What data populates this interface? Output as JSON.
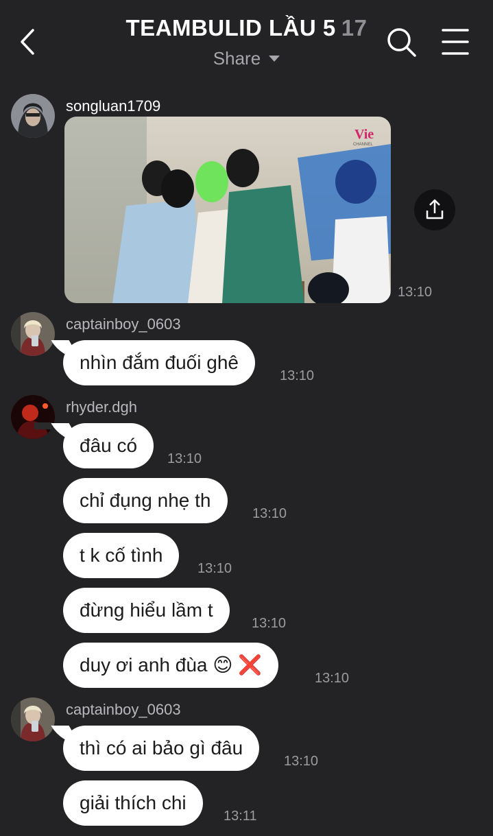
{
  "header": {
    "back_icon": "chevron-left-icon",
    "title": "TEAMBULID LẦU 5",
    "member_count": "17",
    "subtitle": "Share",
    "search_icon": "search-icon",
    "menu_icon": "hamburger-menu-icon"
  },
  "photo_message": {
    "username": "songluan1709",
    "time": "13:10",
    "watermark": "Vie",
    "watermark_sub": "CHANNEL"
  },
  "groups": [
    {
      "username": "captainboy_0603",
      "messages": [
        {
          "text": "nhìn đắm đuối ghê",
          "time": "13:10"
        }
      ]
    },
    {
      "username": "rhyder.dgh",
      "messages": [
        {
          "text": "đâu có",
          "time": "13:10"
        },
        {
          "text": "chỉ đụng nhẹ th",
          "time": "13:10"
        },
        {
          "text": "t k cố tình",
          "time": "13:10"
        },
        {
          "text": "đừng hiểu lầm t",
          "time": "13:10"
        },
        {
          "text": "duy ơi anh đùa",
          "emoji": "😊",
          "emoji2": "❌",
          "time": "13:10"
        }
      ]
    },
    {
      "username": "captainboy_0603",
      "messages": [
        {
          "text": "thì có ai bảo gì đâu",
          "time": "13:10"
        },
        {
          "text": "giải thích chi",
          "time": "13:11"
        }
      ]
    }
  ],
  "colors": {
    "background": "#232325",
    "bubble": "#ffffff",
    "bubble_text": "#1c1c1e",
    "secondary_text": "#9c9ca0"
  }
}
